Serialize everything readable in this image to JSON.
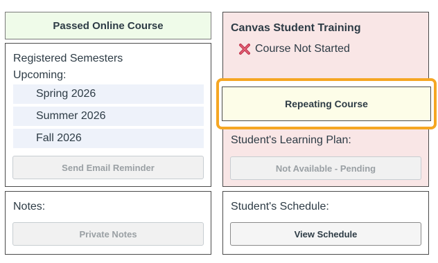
{
  "banner": {
    "label": "Passed Online Course"
  },
  "semesters": {
    "heading": "Registered Semesters",
    "upcoming_label": "Upcoming:",
    "items": [
      "Spring 2026",
      "Summer 2026",
      "Fall 2026"
    ],
    "email_button": "Send Email Reminder"
  },
  "training": {
    "title": "Canvas Student Training",
    "status": "Course Not Started",
    "status_icon": "x-icon",
    "status_color": "#c0334b"
  },
  "repeat": {
    "label": "Repeating Course",
    "highlight_color": "#f5a623"
  },
  "learning_plan": {
    "label": "Student's Learning Plan:",
    "button": "Not Available - Pending"
  },
  "notes": {
    "label": "Notes:",
    "button": "Private Notes"
  },
  "schedule": {
    "label": "Student's Schedule:",
    "button": "View Schedule"
  }
}
